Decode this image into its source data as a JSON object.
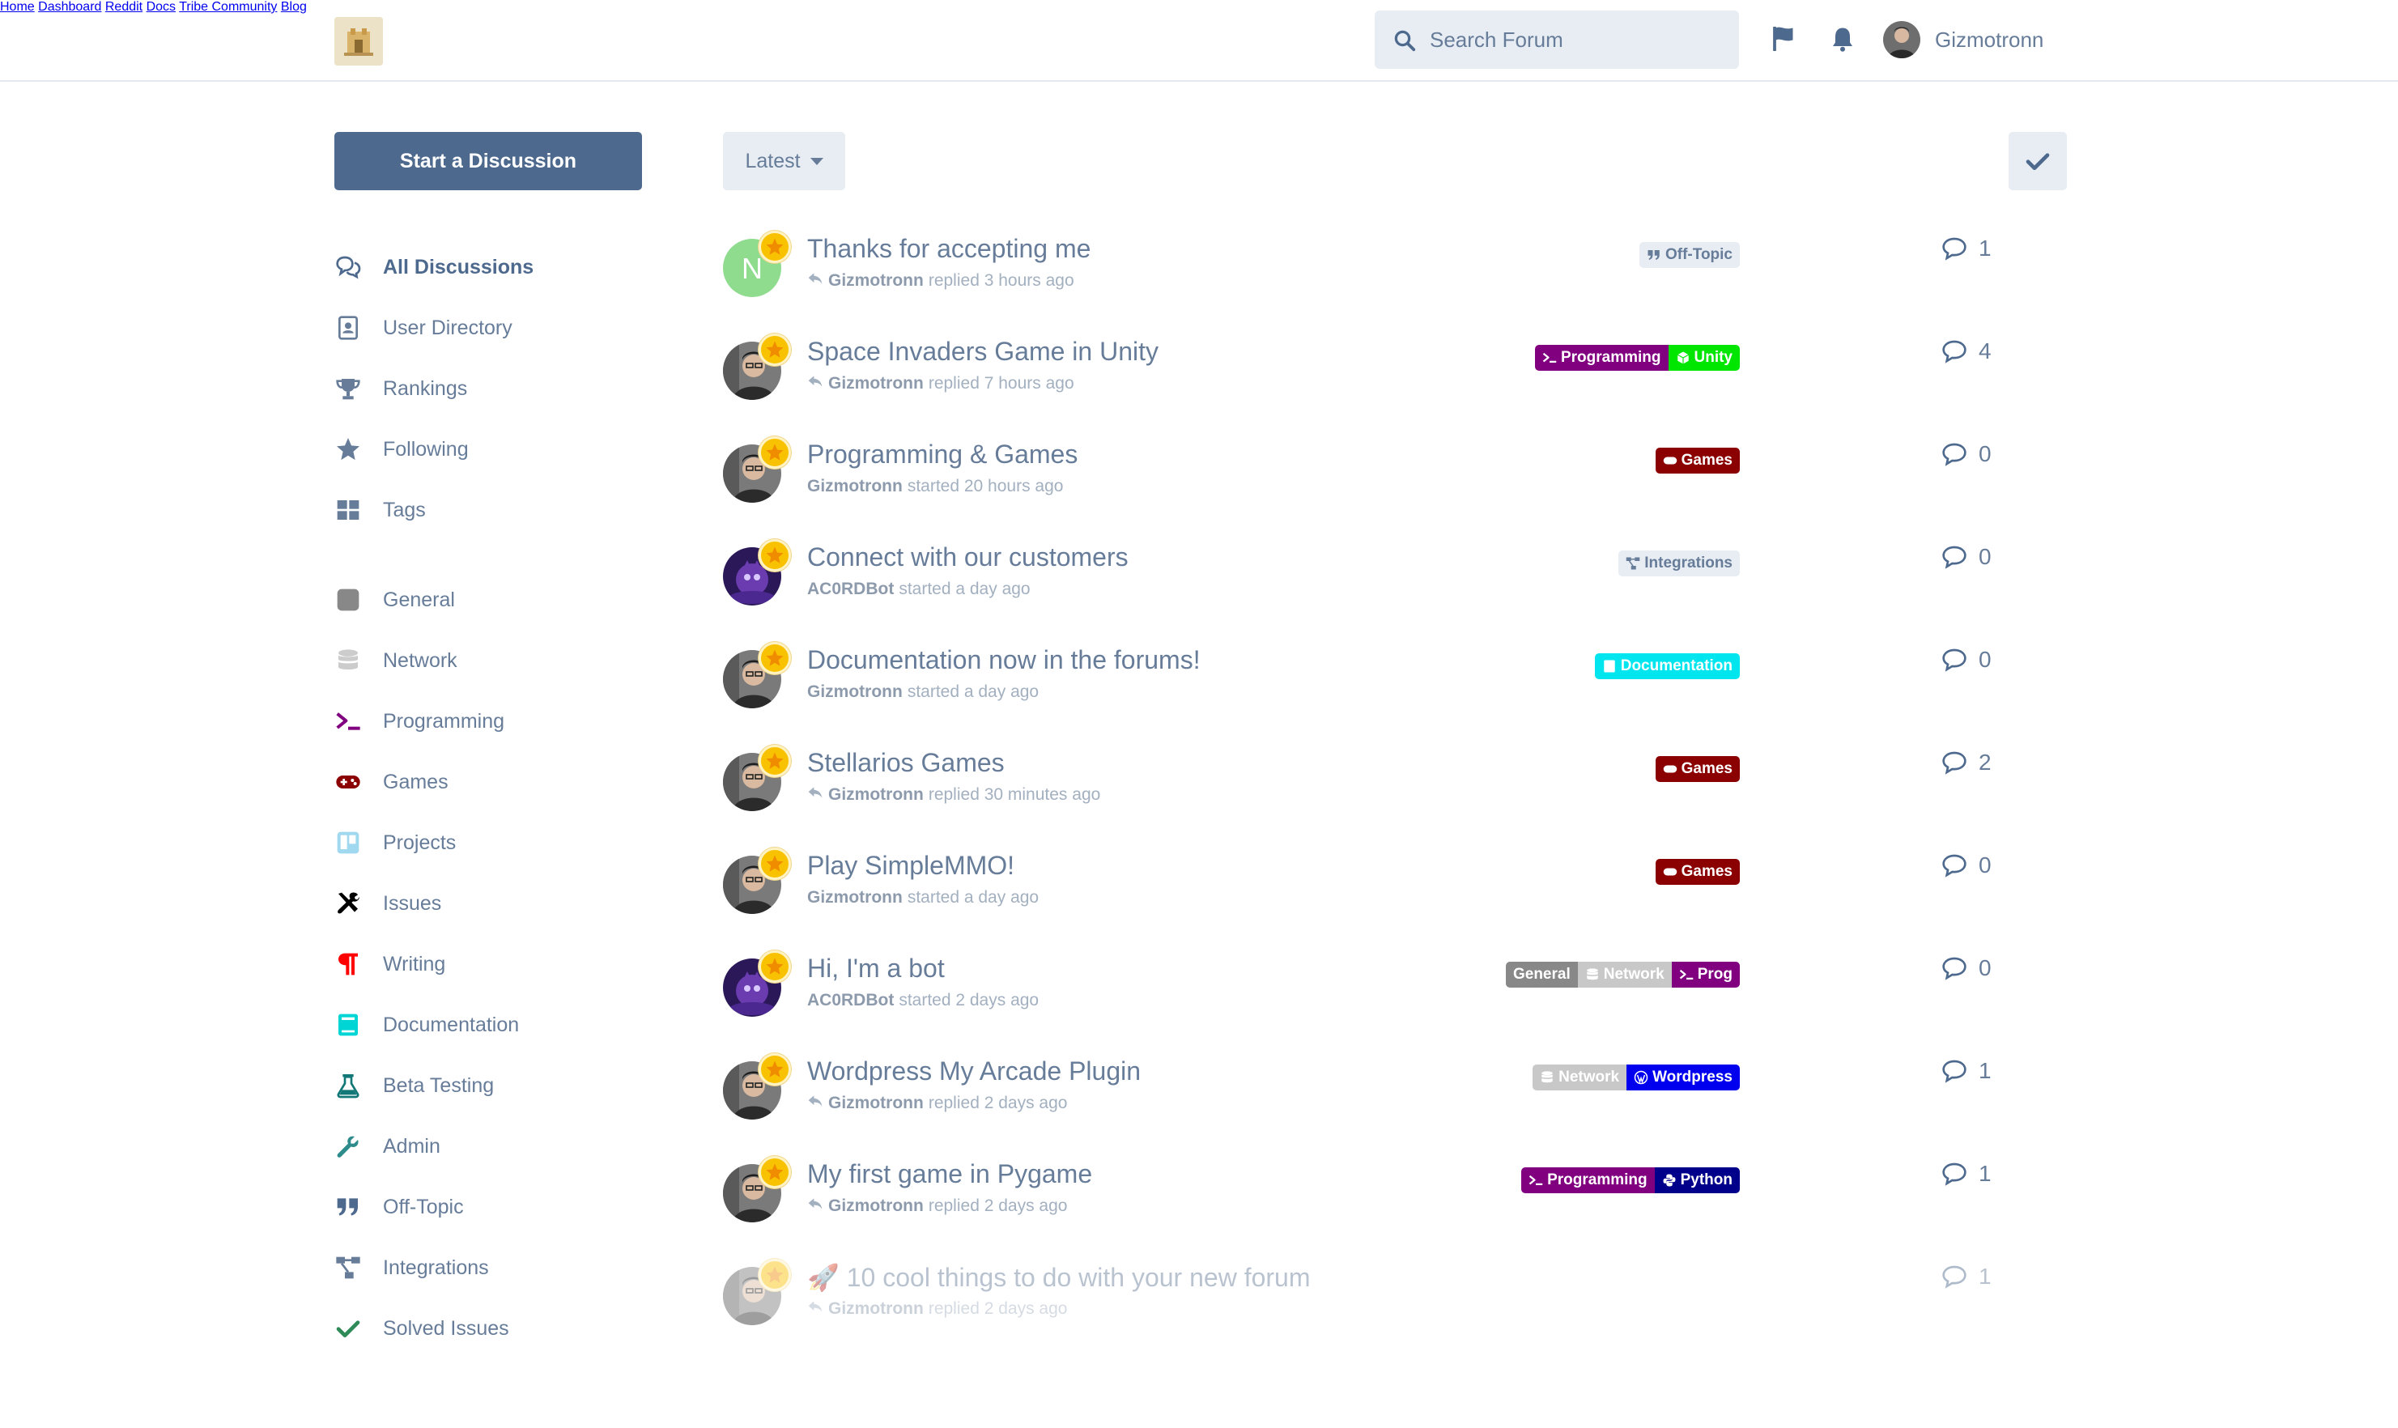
{
  "header": {
    "nav": [
      {
        "label": "Home"
      },
      {
        "label": "Dashboard"
      },
      {
        "label": "Reddit"
      },
      {
        "label": "Docs"
      },
      {
        "label": "Tribe Community"
      },
      {
        "label": "Blog"
      }
    ],
    "search_placeholder": "Search Forum",
    "user_name": "Gizmotronn",
    "icons": [
      "flag-icon",
      "bell-icon"
    ]
  },
  "sidebar": {
    "start_label": "Start a Discussion",
    "items": [
      {
        "label": "All Discussions",
        "icon": "comments-icon",
        "color": "#4d698e"
      },
      {
        "label": "User Directory",
        "icon": "address-book-icon",
        "color": "#667c99"
      },
      {
        "label": "Rankings",
        "icon": "trophy-icon",
        "color": "#667c99"
      },
      {
        "label": "Following",
        "icon": "star-icon",
        "color": "#667c99"
      },
      {
        "label": "Tags",
        "icon": "tags-grid-icon",
        "color": "#667c99"
      },
      {
        "label": "General",
        "icon": "square-icon",
        "color": "#888888"
      },
      {
        "label": "Network",
        "icon": "database-icon",
        "color": "#cccccc"
      },
      {
        "label": "Programming",
        "icon": "terminal-icon",
        "color": "#800080"
      },
      {
        "label": "Games",
        "icon": "gamepad-icon",
        "color": "#8b0000"
      },
      {
        "label": "Projects",
        "icon": "trello-icon",
        "color": "#a0d8ef"
      },
      {
        "label": "Issues",
        "icon": "tools-icon",
        "color": "#000000"
      },
      {
        "label": "Writing",
        "icon": "paragraph-icon",
        "color": "#ff0000"
      },
      {
        "label": "Documentation",
        "icon": "book-icon",
        "color": "#00d5d5"
      },
      {
        "label": "Beta Testing",
        "icon": "flask-icon",
        "color": "#117777"
      },
      {
        "label": "Admin",
        "icon": "wrench-icon",
        "color": "#2e8b8b"
      },
      {
        "label": "Off-Topic",
        "icon": "quote-icon",
        "color": "#4d698e"
      },
      {
        "label": "Integrations",
        "icon": "project-diagram-icon",
        "color": "#667c99"
      },
      {
        "label": "Solved Issues",
        "icon": "check-icon",
        "color": "#2e8b57"
      }
    ]
  },
  "toolbar": {
    "sort_label": "Latest",
    "mark_read_icon": "check-icon"
  },
  "discussions": [
    {
      "title": "Thanks for accepting me",
      "author": "Gizmotronn",
      "action": "replied 3 hours ago",
      "replied": true,
      "avatar": "letter-n",
      "avatar_letter": "N",
      "replies": "1",
      "tags": [
        {
          "label": "Off-Topic",
          "icon": "quote-icon",
          "bg": "#e7edf3",
          "fg": "#667c99"
        }
      ]
    },
    {
      "title": "Space Invaders Game in Unity",
      "author": "Gizmotronn",
      "action": "replied 7 hours ago",
      "replied": true,
      "avatar": "photo",
      "replies": "4",
      "tags": [
        {
          "label": "Programming",
          "icon": "terminal-icon",
          "bg": "#800080",
          "fg": "#ffffff"
        },
        {
          "label": "Unity",
          "icon": "cube-icon",
          "bg": "#00e600",
          "fg": "#ffffff"
        }
      ]
    },
    {
      "title": "Programming & Games",
      "author": "Gizmotronn",
      "action": "started 20 hours ago",
      "replied": false,
      "avatar": "photo",
      "replies": "0",
      "tags": [
        {
          "label": "Games",
          "icon": "gamepad-icon",
          "bg": "#8b0000",
          "fg": "#ffffff"
        }
      ]
    },
    {
      "title": "Connect with our customers",
      "author": "AC0RDBot",
      "action": "started a day ago",
      "replied": false,
      "avatar": "bot",
      "replies": "0",
      "tags": [
        {
          "label": "Integrations",
          "icon": "project-diagram-icon",
          "bg": "#e7edf3",
          "fg": "#667c99"
        }
      ]
    },
    {
      "title": "Documentation now in the forums!",
      "author": "Gizmotronn",
      "action": "started a day ago",
      "replied": false,
      "avatar": "photo",
      "replies": "0",
      "tags": [
        {
          "label": "Documentation",
          "icon": "book-icon",
          "bg": "#00e5ee",
          "fg": "#ffffff"
        }
      ]
    },
    {
      "title": "Stellarios Games",
      "author": "Gizmotronn",
      "action": "replied 30 minutes ago",
      "replied": true,
      "avatar": "photo",
      "replies": "2",
      "tags": [
        {
          "label": "Games",
          "icon": "gamepad-icon",
          "bg": "#8b0000",
          "fg": "#ffffff"
        }
      ]
    },
    {
      "title": "Play SimpleMMO!",
      "author": "Gizmotronn",
      "action": "started a day ago",
      "replied": false,
      "avatar": "photo",
      "replies": "0",
      "tags": [
        {
          "label": "Games",
          "icon": "gamepad-icon",
          "bg": "#8b0000",
          "fg": "#ffffff"
        }
      ]
    },
    {
      "title": "Hi, I'm a bot",
      "author": "AC0RDBot",
      "action": "started 2 days ago",
      "replied": false,
      "avatar": "bot",
      "replies": "0",
      "tags": [
        {
          "label": "General",
          "icon": "",
          "bg": "#888888",
          "fg": "#ffffff"
        },
        {
          "label": "Network",
          "icon": "database-icon",
          "bg": "#c8c8c8",
          "fg": "#ffffff"
        },
        {
          "label": "Prog",
          "icon": "terminal-icon",
          "bg": "#800080",
          "fg": "#ffffff"
        }
      ]
    },
    {
      "title": "Wordpress My Arcade Plugin",
      "author": "Gizmotronn",
      "action": "replied 2 days ago",
      "replied": true,
      "avatar": "photo",
      "replies": "1",
      "tags": [
        {
          "label": "Network",
          "icon": "database-icon",
          "bg": "#c8c8c8",
          "fg": "#ffffff"
        },
        {
          "label": "Wordpress",
          "icon": "wordpress-icon",
          "bg": "#0000ee",
          "fg": "#ffffff"
        }
      ]
    },
    {
      "title": "My first game in Pygame",
      "author": "Gizmotronn",
      "action": "replied 2 days ago",
      "replied": true,
      "avatar": "photo",
      "replies": "1",
      "tags": [
        {
          "label": "Programming",
          "icon": "terminal-icon",
          "bg": "#800080",
          "fg": "#ffffff"
        },
        {
          "label": "Python",
          "icon": "python-icon",
          "bg": "#00008b",
          "fg": "#ffffff"
        }
      ]
    },
    {
      "title": "🚀 10 cool things to do with your new forum",
      "author": "Gizmotronn",
      "action": "replied 2 days ago",
      "replied": true,
      "avatar": "photo",
      "replies": "1",
      "faded": true,
      "tags": []
    }
  ]
}
